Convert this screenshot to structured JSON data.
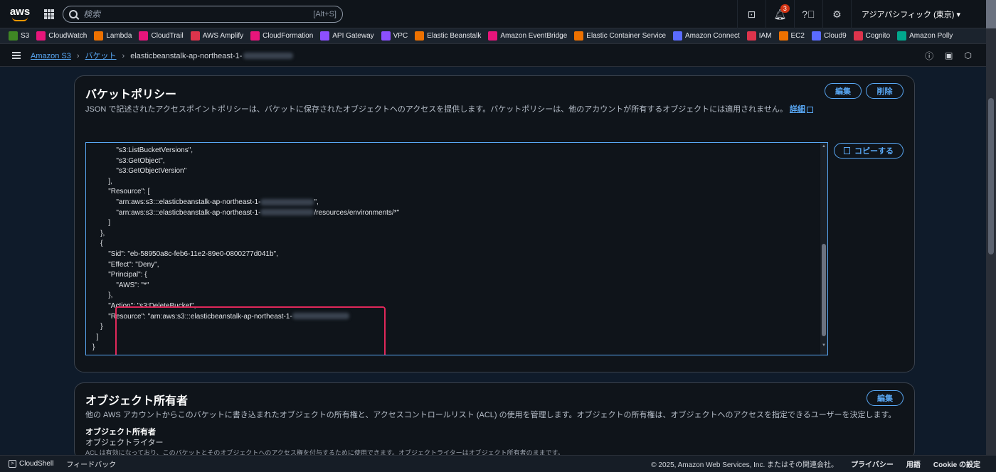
{
  "topnav": {
    "logo": "aws",
    "search_placeholder": "検索",
    "search_shortcut": "[Alt+S]",
    "notification_count": "3",
    "region": "アジアパシフィック (東京) ▾"
  },
  "favorites": [
    {
      "label": "S3",
      "color": "#3f8624"
    },
    {
      "label": "CloudWatch",
      "color": "#e7157b"
    },
    {
      "label": "Lambda",
      "color": "#ed7100"
    },
    {
      "label": "CloudTrail",
      "color": "#e7157b"
    },
    {
      "label": "AWS Amplify",
      "color": "#dd344c"
    },
    {
      "label": "CloudFormation",
      "color": "#e7157b"
    },
    {
      "label": "API Gateway",
      "color": "#8c4fff"
    },
    {
      "label": "VPC",
      "color": "#8c4fff"
    },
    {
      "label": "Elastic Beanstalk",
      "color": "#ed7100"
    },
    {
      "label": "Amazon EventBridge",
      "color": "#e7157b"
    },
    {
      "label": "Elastic Container Service",
      "color": "#ed7100"
    },
    {
      "label": "Amazon Connect",
      "color": "#5a6bff"
    },
    {
      "label": "IAM",
      "color": "#dd344c"
    },
    {
      "label": "EC2",
      "color": "#ed7100"
    },
    {
      "label": "Cloud9",
      "color": "#5a6bff"
    },
    {
      "label": "Cognito",
      "color": "#dd344c"
    },
    {
      "label": "Amazon Polly",
      "color": "#01a88d"
    }
  ],
  "breadcrumb": {
    "root": "Amazon S3",
    "level1": "バケット",
    "current": "elasticbeanstalk-ap-northeast-1-"
  },
  "policy": {
    "title": "バケットポリシー",
    "description": "JSON で記述されたアクセスポイントポリシーは、バケットに保存されたオブジェクトへのアクセスを提供します。バケットポリシーは、他のアカウントが所有するオブジェクトには適用されません。",
    "link": "詳細",
    "edit": "編集",
    "delete": "削除",
    "copy": "コピーする",
    "code_lines": [
      "            \"s3:ListBucketVersions\",",
      "            \"s3:GetObject\",",
      "            \"s3:GetObjectVersion\"",
      "        ],",
      "        \"Resource\": [",
      "            \"arn:aws:s3:::elasticbeanstalk-ap-northeast-1-",
      "            \"arn:aws:s3:::elasticbeanstalk-ap-northeast-1-",
      "        ]",
      "    },",
      "    {",
      "        \"Sid\": \"eb-58950a8c-feb6-11e2-89e0-0800277d041b\",",
      "        \"Effect\": \"Deny\",",
      "        \"Principal\": {",
      "            \"AWS\": \"*\"",
      "        },",
      "        \"Action\": \"s3:DeleteBucket\",",
      "        \"Resource\": \"arn:aws:s3:::elasticbeanstalk-ap-northeast-1-",
      "    }",
      "  ]",
      "}"
    ],
    "resource1_suffix": "\",",
    "resource2_suffix": "/resources/environments/*\""
  },
  "ownership": {
    "title": "オブジェクト所有者",
    "description": "他の AWS アカウントからこのバケットに書き込まれたオブジェクトの所有権と、アクセスコントロールリスト (ACL) の使用を管理します。オブジェクトの所有権は、オブジェクトへのアクセスを指定できるユーザーを決定します。",
    "edit": "編集",
    "sub_label": "オブジェクト所有者",
    "sub_value": "オブジェクトライター",
    "note": "ACL は有効になっており、このバケットとそのオブジェクトへのアクセス権を付与するために使用できます。オブジェクトライターはオブジェクト所有者のままです。"
  },
  "footer": {
    "cloudshell": "CloudShell",
    "feedback": "フィードバック",
    "copyright": "© 2025, Amazon Web Services, Inc. またはその関連会社。",
    "privacy": "プライバシー",
    "terms": "用語",
    "cookie": "Cookie の設定"
  }
}
